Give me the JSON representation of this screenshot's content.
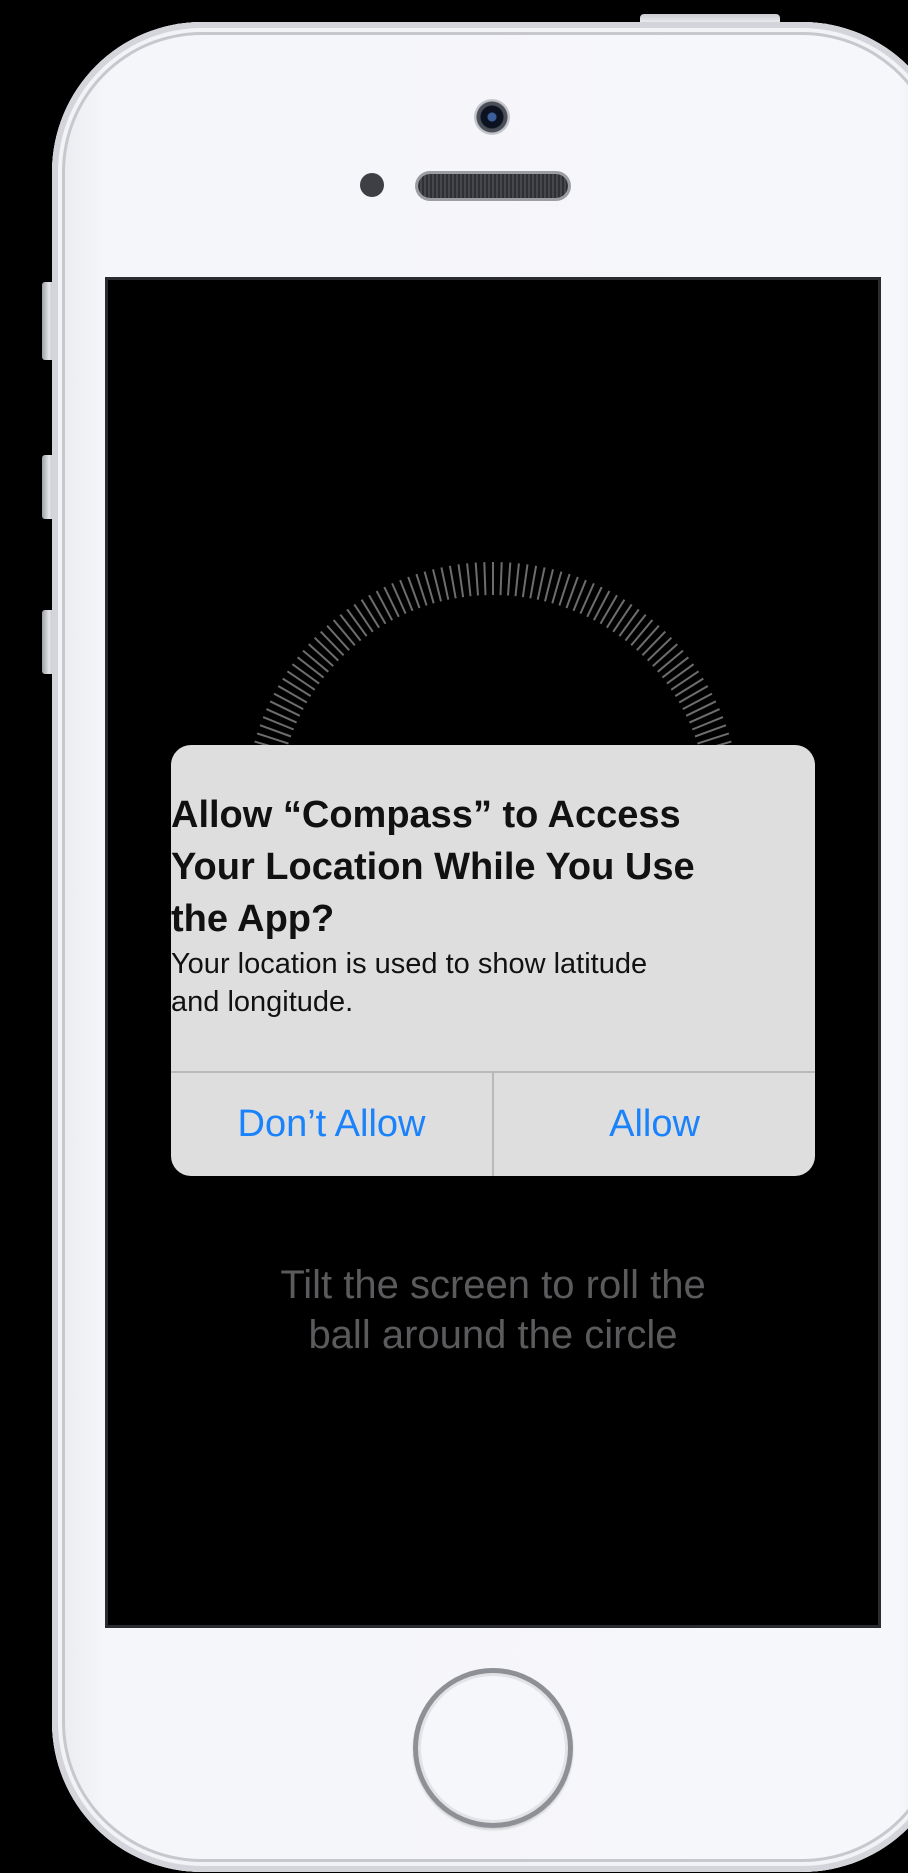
{
  "alert": {
    "title_lines": [
      "Allow “Compass” to Access",
      "Your Location While You Use",
      "the App?"
    ],
    "message_lines": [
      "Your location is used to show latitude",
      "and longitude."
    ],
    "deny_label": "Don’t Allow",
    "allow_label": "Allow"
  },
  "screen": {
    "hint_lines": [
      "Tilt the screen to roll the",
      "ball around the circle"
    ]
  },
  "colors": {
    "button_text": "#1a82fb",
    "alert_background": "#dedede",
    "screen_background": "#000000",
    "hint_text": "#5b5b5e"
  }
}
